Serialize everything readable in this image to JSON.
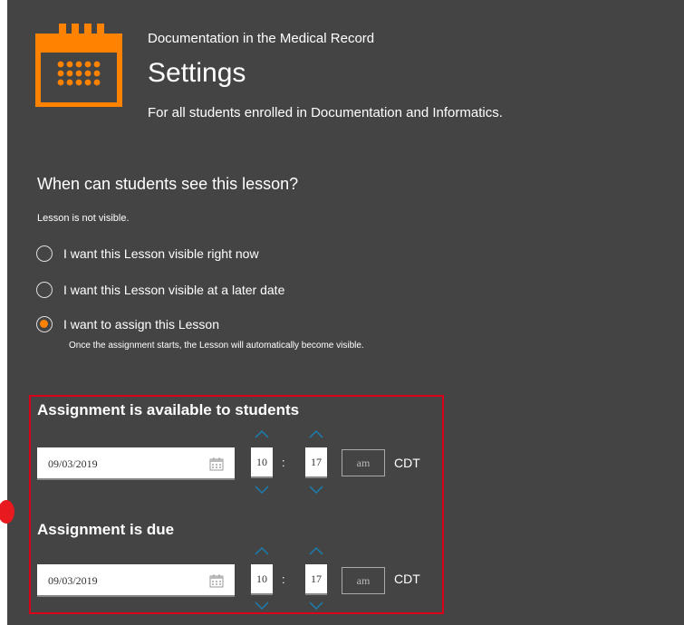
{
  "header": {
    "course": "Documentation in the Medical Record",
    "title": "Settings",
    "subtitle": "For all students enrolled in Documentation and Informatics."
  },
  "visibility": {
    "question": "When can students see this lesson?",
    "status": "Lesson is not visible.",
    "options": [
      {
        "label": "I want this Lesson visible right now",
        "selected": false
      },
      {
        "label": "I want this Lesson visible at a later date",
        "selected": false
      },
      {
        "label": "I want to assign this Lesson",
        "selected": true
      }
    ],
    "assign_note": "Once the assignment starts, the Lesson will automatically become visible."
  },
  "available": {
    "heading": "Assignment is available to students",
    "date": "09/03/2019",
    "hour": "10",
    "separator": ":",
    "minute": "17",
    "ampm": "am",
    "timezone": "CDT"
  },
  "due": {
    "heading": "Assignment is due",
    "date": "09/03/2019",
    "hour": "10",
    "separator": ":",
    "minute": "17",
    "ampm": "am",
    "timezone": "CDT"
  },
  "colors": {
    "panel": "#444444",
    "accent": "#ff8200",
    "chevron": "#1a7fb0",
    "highlight": "#d9001b"
  },
  "icons": [
    "calendar-logo-icon",
    "calendar-icon",
    "chevron-up-icon",
    "chevron-down-icon"
  ]
}
